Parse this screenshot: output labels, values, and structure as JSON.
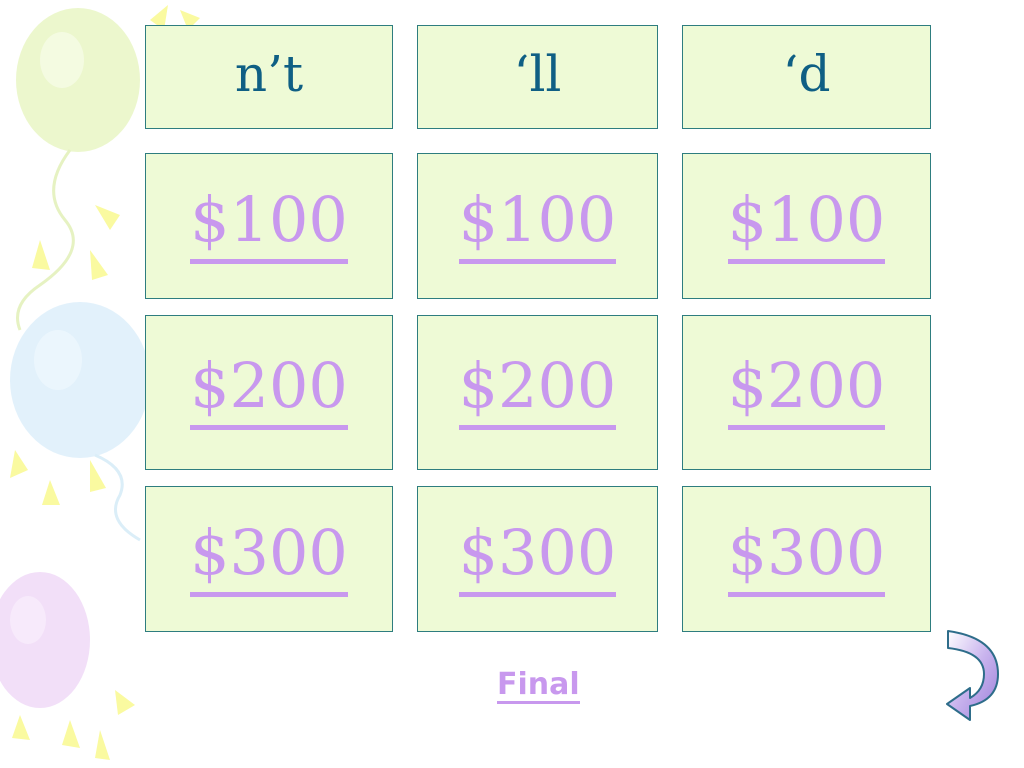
{
  "board": {
    "headers": [
      "n’t",
      "‘ll",
      "‘d"
    ],
    "rows": [
      [
        "$100",
        "$100",
        "$100"
      ],
      [
        "$200",
        "$200",
        "$200"
      ],
      [
        "$300",
        "$300",
        "$300"
      ]
    ]
  },
  "footer": {
    "final_label": "Final"
  },
  "decor_icon": "balloons-confetti",
  "nav_icon": "curved-back-arrow-icon",
  "colors": {
    "cell_bg": "#eefad6",
    "cell_border": "#2e7d7f",
    "header_text": "#0f5f84",
    "link": "#c898ee"
  }
}
